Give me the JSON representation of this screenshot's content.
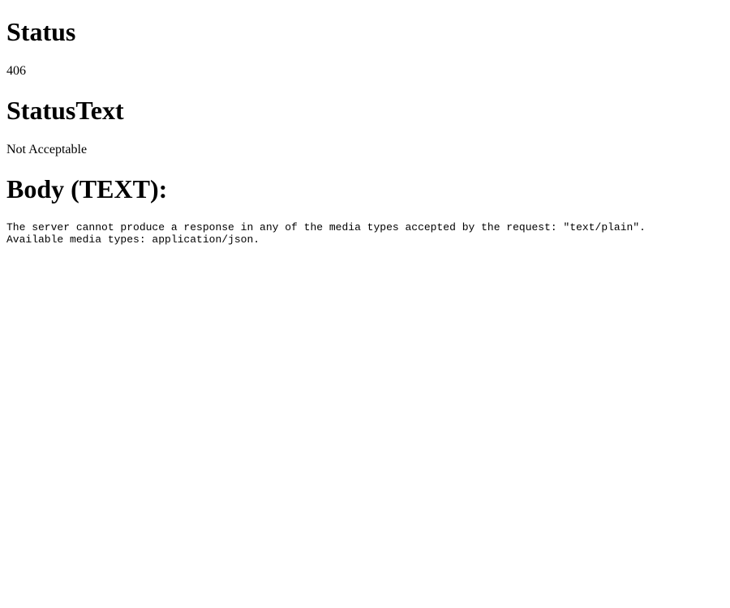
{
  "status": {
    "heading": "Status",
    "value": "406"
  },
  "status_text": {
    "heading": "StatusText",
    "value": "Not Acceptable"
  },
  "body": {
    "heading": "Body (TEXT):",
    "content": "The server cannot produce a response in any of the media types accepted by the request: \"text/plain\".\nAvailable media types: application/json."
  }
}
